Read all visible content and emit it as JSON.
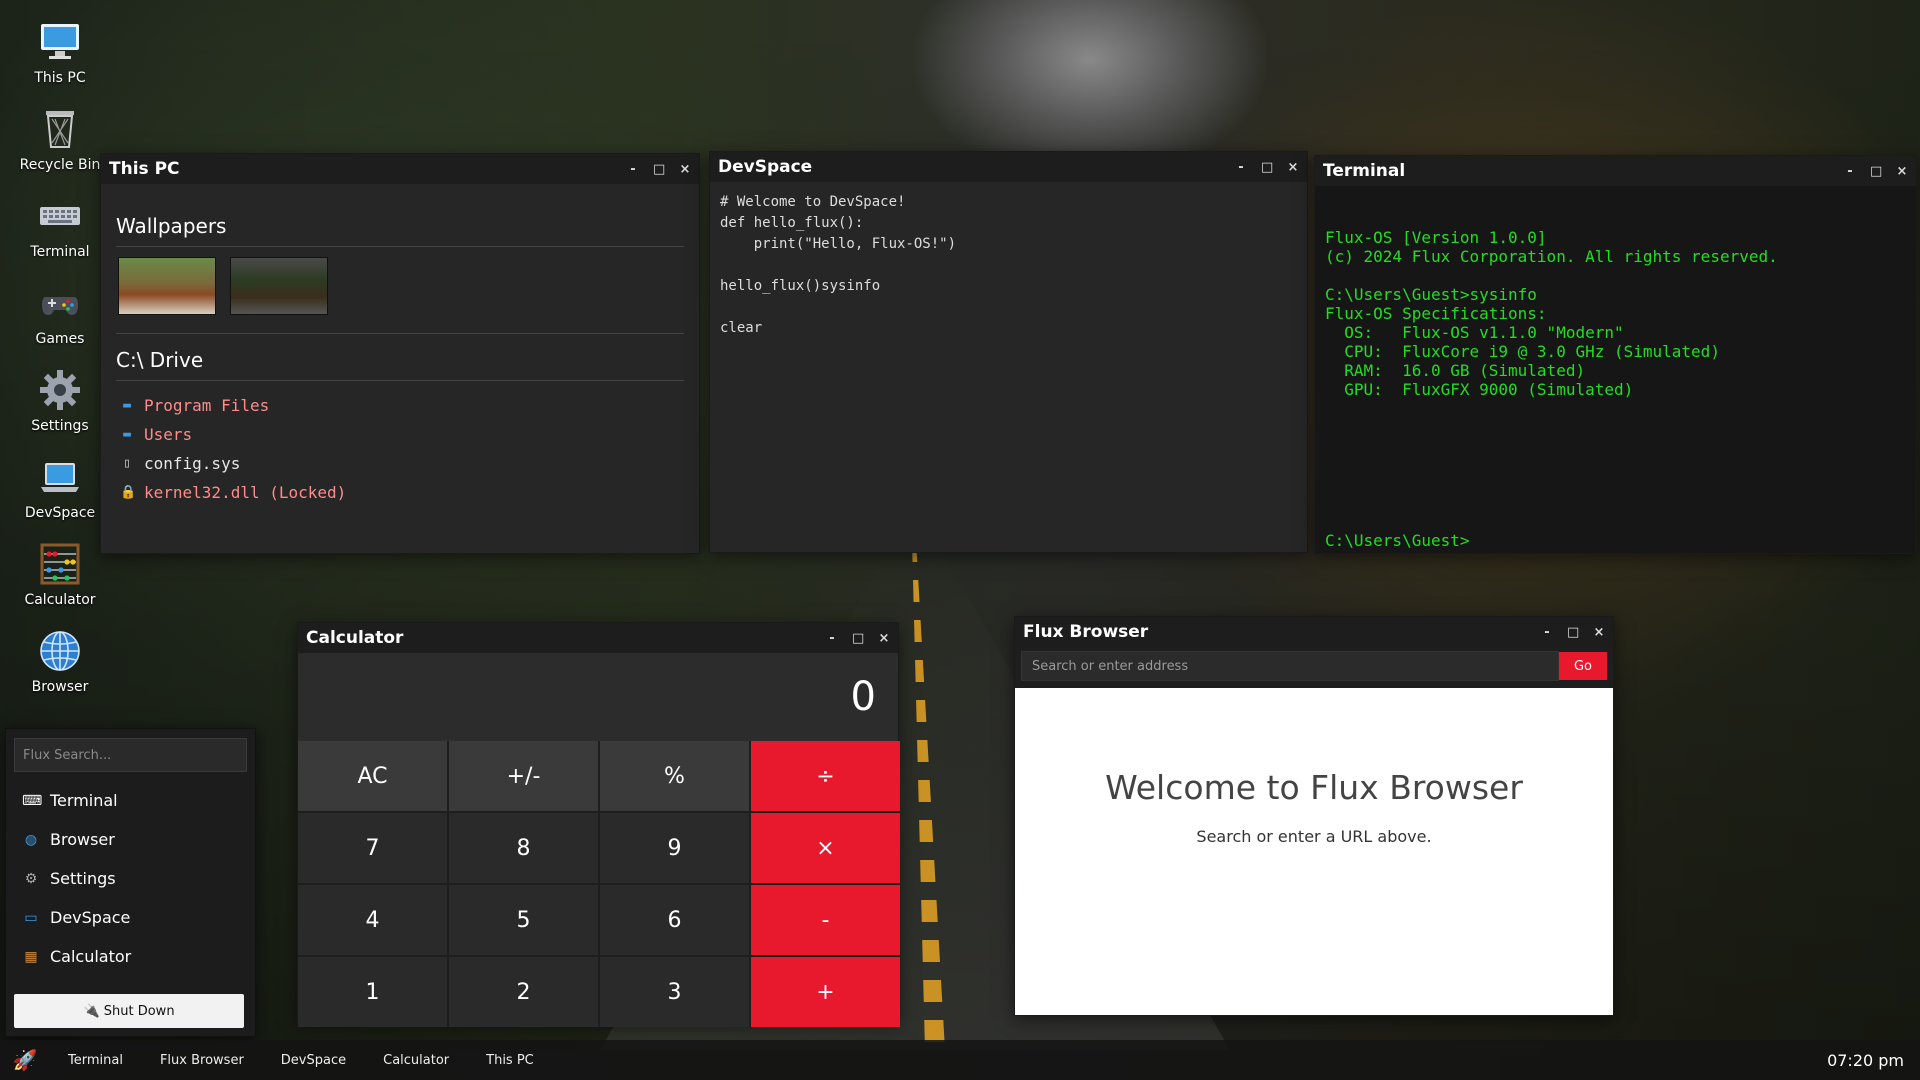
{
  "desktop": {
    "icons": [
      {
        "label": "This PC",
        "icon": "monitor-icon"
      },
      {
        "label": "Recycle Bin",
        "icon": "recycle-bin-icon"
      },
      {
        "label": "Terminal",
        "icon": "keyboard-icon"
      },
      {
        "label": "Games",
        "icon": "gamepad-icon"
      },
      {
        "label": "Settings",
        "icon": "gear-icon"
      },
      {
        "label": "DevSpace",
        "icon": "laptop-icon"
      },
      {
        "label": "Calculator",
        "icon": "abacus-icon"
      },
      {
        "label": "Browser",
        "icon": "globe-icon"
      }
    ]
  },
  "window_controls": {
    "minimize": "-",
    "maximize": "□",
    "close": "×"
  },
  "this_pc": {
    "title": "This PC",
    "wallpapers_title": "Wallpapers",
    "drive_title": "C:\\ Drive",
    "files": [
      {
        "name": "Program Files",
        "type": "folder",
        "color": "#ff8b8b"
      },
      {
        "name": "Users",
        "type": "folder",
        "color": "#ff8b8b"
      },
      {
        "name": "config.sys",
        "type": "file",
        "color": "#e6e6e6"
      },
      {
        "name": "kernel32.dll (Locked)",
        "type": "locked",
        "color": "#ff8b8b"
      }
    ]
  },
  "devspace": {
    "title": "DevSpace",
    "code": "# Welcome to DevSpace!\ndef hello_flux():\n    print(\"Hello, Flux-OS!\")\n\nhello_flux()sysinfo\n\nclear"
  },
  "terminal": {
    "title": "Terminal",
    "output": "Flux-OS [Version 1.0.0]\n(c) 2024 Flux Corporation. All rights reserved.\n\nC:\\Users\\Guest>sysinfo\nFlux-OS Specifications:\n  OS:   Flux-OS v1.1.0 \"Modern\"\n  CPU:  FluxCore i9 @ 3.0 GHz (Simulated)\n  RAM:  16.0 GB (Simulated)\n  GPU:  FluxGFX 9000 (Simulated)",
    "prompt": "C:\\Users\\Guest>"
  },
  "calculator": {
    "title": "Calculator",
    "display": "0",
    "buttons": [
      {
        "label": "AC",
        "kind": "fn"
      },
      {
        "label": "+/-",
        "kind": "fn"
      },
      {
        "label": "%",
        "kind": "fn"
      },
      {
        "label": "÷",
        "kind": "op"
      },
      {
        "label": "7",
        "kind": "num"
      },
      {
        "label": "8",
        "kind": "num"
      },
      {
        "label": "9",
        "kind": "num"
      },
      {
        "label": "×",
        "kind": "op"
      },
      {
        "label": "4",
        "kind": "num"
      },
      {
        "label": "5",
        "kind": "num"
      },
      {
        "label": "6",
        "kind": "num"
      },
      {
        "label": "-",
        "kind": "op"
      },
      {
        "label": "1",
        "kind": "num"
      },
      {
        "label": "2",
        "kind": "num"
      },
      {
        "label": "3",
        "kind": "num"
      },
      {
        "label": "+",
        "kind": "op"
      }
    ]
  },
  "browser": {
    "title": "Flux Browser",
    "address_placeholder": "Search or enter address",
    "go_label": "Go",
    "welcome_heading": "Welcome to Flux Browser",
    "welcome_text": "Search or enter a URL above."
  },
  "start_menu": {
    "search_placeholder": "Flux Search...",
    "items": [
      {
        "label": "Terminal",
        "icon": "keyboard-icon"
      },
      {
        "label": "Browser",
        "icon": "globe-icon"
      },
      {
        "label": "Settings",
        "icon": "gear-icon"
      },
      {
        "label": "DevSpace",
        "icon": "laptop-icon"
      },
      {
        "label": "Calculator",
        "icon": "abacus-icon"
      }
    ],
    "shutdown_label": "🔌 Shut Down"
  },
  "taskbar": {
    "start_icon": "rocket-icon",
    "items": [
      "Terminal",
      "Flux Browser",
      "DevSpace",
      "Calculator",
      "This PC"
    ],
    "clock": "07:20 pm"
  },
  "colors": {
    "accent": "#e8192c",
    "terminal_green": "#22dd22"
  }
}
